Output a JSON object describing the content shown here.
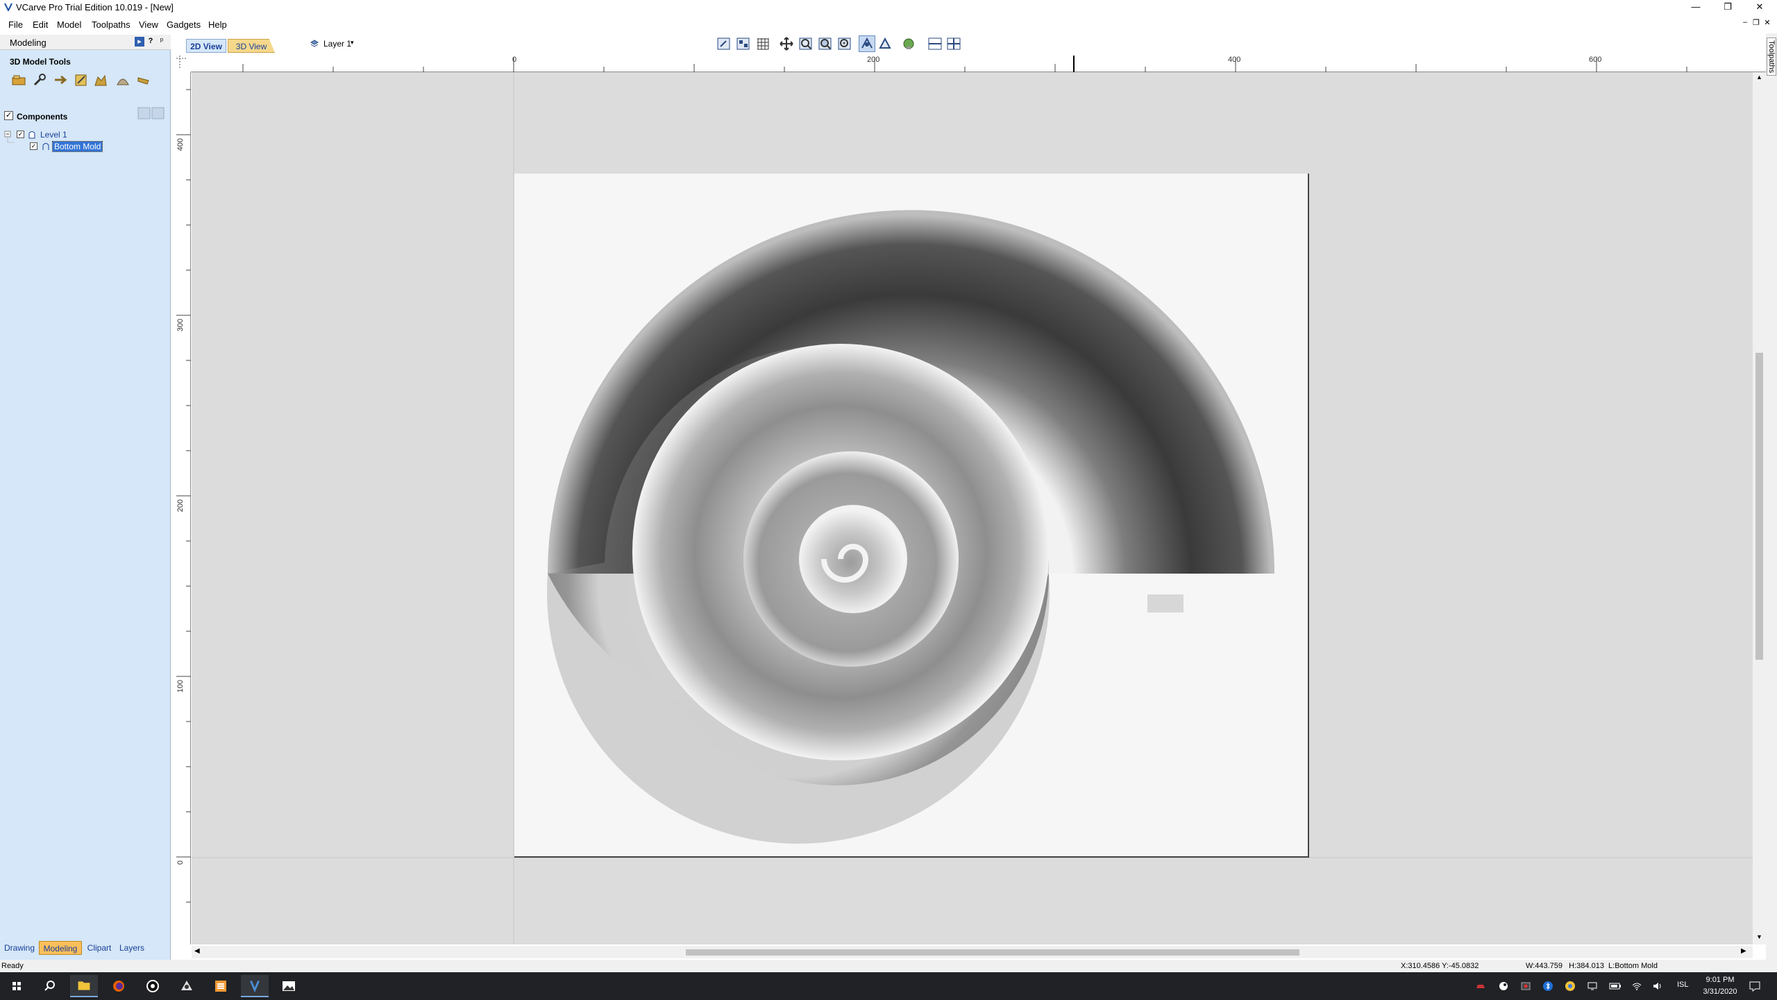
{
  "window": {
    "title": "VCarve Pro Trial Edition 10.019 - [New]",
    "controls": {
      "minimize": "—",
      "restore": "❐",
      "close": "✕"
    }
  },
  "menu": [
    "File",
    "Edit",
    "Model",
    "Toolpaths",
    "View",
    "Gadgets",
    "Help"
  ],
  "left_panel": {
    "title": "Modeling",
    "help_glyph": "?",
    "pin_glyph": "ᵖ",
    "tools_title": "3D Model Tools",
    "tool_icons": [
      "create-component-icon",
      "wrench-icon",
      "move-arrow-icon",
      "edit-icon",
      "shape-icon",
      "dome-icon",
      "chisel-icon"
    ],
    "components_title": "Components",
    "tree": [
      {
        "label": "Level 1",
        "checked": true,
        "level": 0,
        "selected": false
      },
      {
        "label": "Bottom Mold",
        "checked": true,
        "level": 1,
        "selected": true
      }
    ],
    "bottom_tabs": [
      "Drawing",
      "Modeling",
      "Clipart",
      "Layers"
    ],
    "active_tab": "Modeling"
  },
  "view_tabs": {
    "active": "2D View",
    "inactive": "3D View"
  },
  "layer_select": "Layer 1",
  "toolbar_icons": [
    "select-icon",
    "node-edit-icon",
    "grid-icon",
    "pan-icon",
    "zoom-box-icon",
    "zoom-fit-icon",
    "zoom-selected-icon",
    "snap-icon",
    "transform-icon",
    "render-icon",
    "split-view-icon",
    "tile-view-icon"
  ],
  "ruler": {
    "top_labels": [
      "0",
      "200",
      "400",
      "600"
    ],
    "left_labels": [
      "400",
      "300",
      "200",
      "100",
      "0"
    ]
  },
  "right_strip": {
    "label": "Toolpaths"
  },
  "status": {
    "ready": "Ready",
    "coords": "X:310.4586 Y:-45.0832",
    "dims": "W:443.759   H:384.013  L:Bottom Mold"
  },
  "taskbar": {
    "apps": [
      "start-icon",
      "search-icon",
      "file-explorer-icon",
      "firefox-icon",
      "obs-icon",
      "inkscape-icon",
      "sublime-icon",
      "vcarve-icon",
      "photos-icon"
    ],
    "tray_lang": "ISL",
    "time": "9:01 PM",
    "date": "3/31/2020"
  },
  "colors": {
    "panel_bg": "#d5e7f8",
    "workspace_bg": "#dcdcdc",
    "sheet_bg": "#f6f6f6",
    "active_tab": "#fbbf5c",
    "selection": "#3374d6",
    "taskbar_bg": "#202226"
  }
}
